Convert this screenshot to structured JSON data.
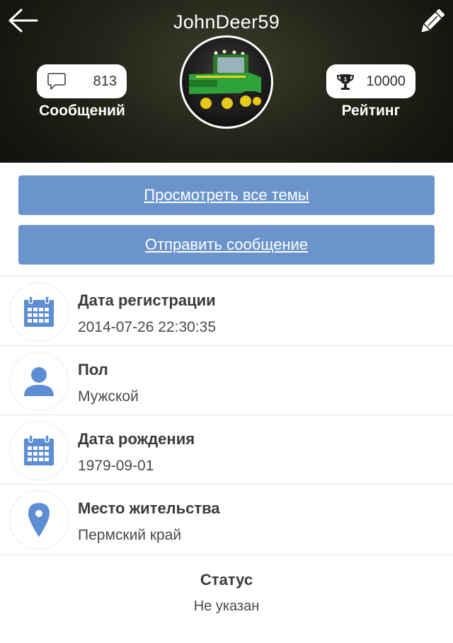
{
  "header": {
    "username": "JohnDeer59",
    "back_icon": "arrow-left-icon",
    "edit_icon": "pencil-icon",
    "avatar_description_icon": "tractor-avatar",
    "messages": {
      "icon": "speech-bubble-icon",
      "value": "813",
      "label": "Сообщений"
    },
    "rating": {
      "icon": "trophy-icon",
      "value": "10000",
      "label": "Рейтинг"
    }
  },
  "actions": {
    "view_topics_label": "Просмотреть все темы",
    "send_message_label": "Отправить сообщение"
  },
  "info": [
    {
      "icon": "calendar-icon",
      "title": "Дата регистрации",
      "value": "2014-07-26 22:30:35"
    },
    {
      "icon": "user-icon",
      "title": "Пол",
      "value": "Мужской"
    },
    {
      "icon": "calendar-icon",
      "title": "Дата рождения",
      "value": "1979-09-01"
    },
    {
      "icon": "map-pin-icon",
      "title": "Место жительства",
      "value": "Пермский край"
    }
  ],
  "status": {
    "title": "Статус",
    "value": "Не указан"
  },
  "colors": {
    "accent": "#6b94cc",
    "icon_blue": "#5d8dd3",
    "header_bg": "#1c1d15"
  }
}
